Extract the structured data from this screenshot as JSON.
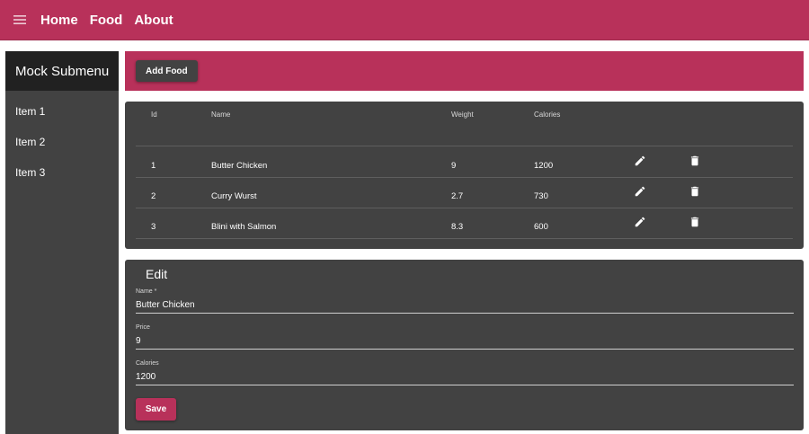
{
  "nav": {
    "links": [
      "Home",
      "Food",
      "About"
    ],
    "accent": "#b8315a"
  },
  "sidebar": {
    "title": "Mock Submenu",
    "items": [
      "Item 1",
      "Item 2",
      "Item 3"
    ]
  },
  "toolbar": {
    "add_label": "Add Food"
  },
  "table": {
    "headers": [
      "Id",
      "Name",
      "Weight",
      "Calories"
    ],
    "rows": [
      {
        "id": "1",
        "name": "Butter Chicken",
        "weight": "9",
        "calories": "1200"
      },
      {
        "id": "2",
        "name": "Curry Wurst",
        "weight": "2.7",
        "calories": "730"
      },
      {
        "id": "3",
        "name": "Blini with Salmon",
        "weight": "8.3",
        "calories": "600"
      }
    ],
    "row_icons": [
      "pencil-icon",
      "trash-icon"
    ]
  },
  "edit": {
    "title": "Edit",
    "name_label": "Name *",
    "name_value": "Butter Chicken",
    "price_label": "Price",
    "price_value": "9",
    "calories_label": "Calories",
    "calories_value": "1200",
    "save_label": "Save"
  }
}
